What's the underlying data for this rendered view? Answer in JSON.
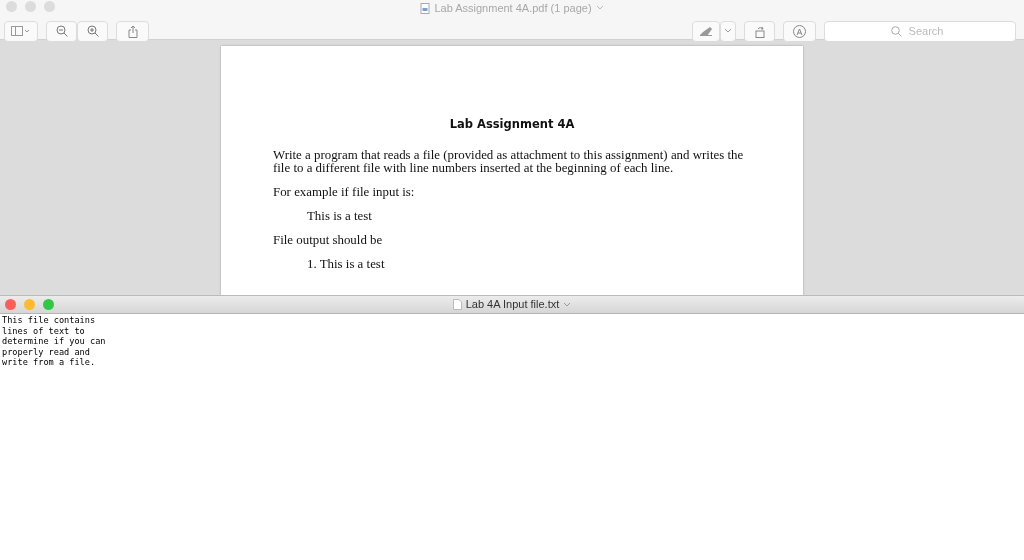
{
  "preview_window": {
    "title": "Lab Assignment 4A.pdf (1 page)",
    "search": {
      "placeholder": "Search"
    },
    "document": {
      "heading": "Lab Assignment 4A",
      "blocks": [
        {
          "kind": "paragraph",
          "text": "Write a program that reads a file (provided as attachment to this assignment) and writes the file to a different file with line numbers inserted at the beginning of each line."
        },
        {
          "kind": "paragraph",
          "text": "For example if file input is:"
        },
        {
          "kind": "indented",
          "text": "This is a test"
        },
        {
          "kind": "paragraph",
          "text": "File output should be"
        },
        {
          "kind": "indented",
          "text": "1. This is a test"
        }
      ]
    }
  },
  "text_window": {
    "title": "Lab 4A Input file.txt",
    "lines": [
      "This file contains",
      "lines of text to",
      "determine if you can",
      "properly read and",
      "write from a file."
    ]
  }
}
